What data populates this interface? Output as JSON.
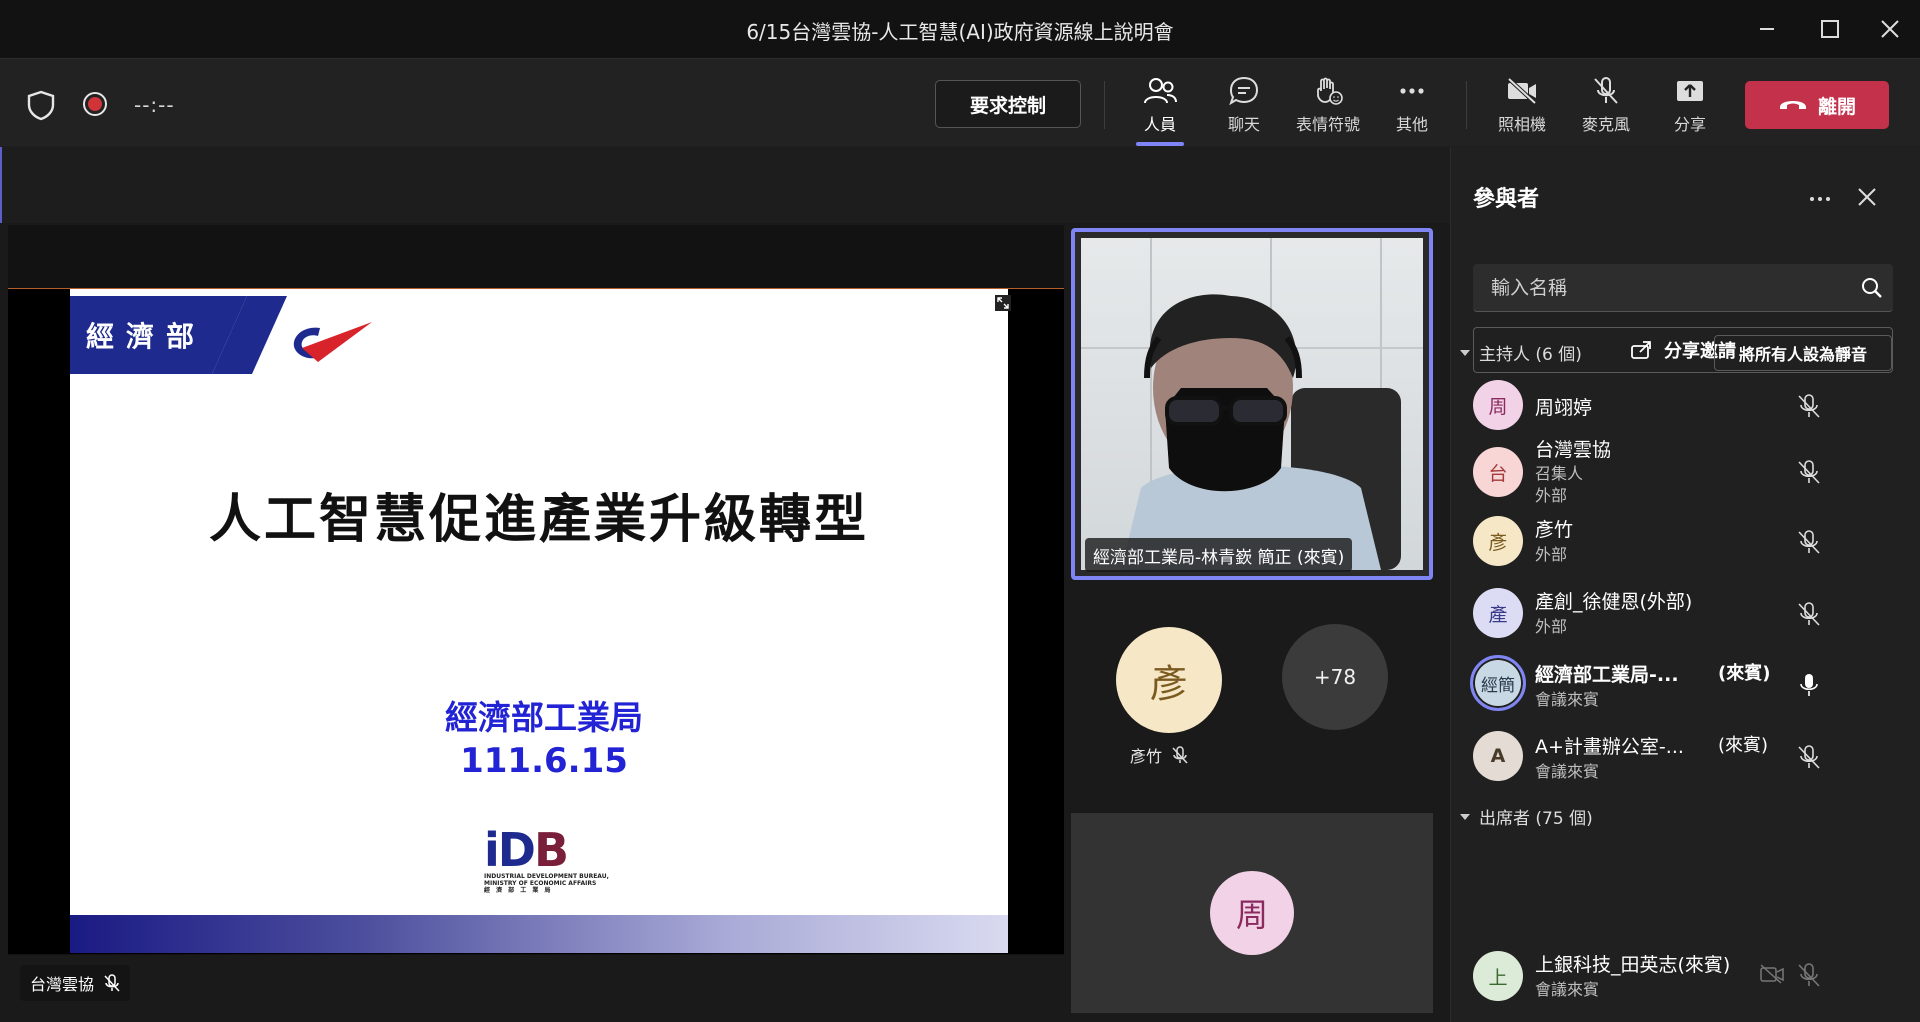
{
  "window": {
    "title": "6/15台灣雲協-人工智慧(AI)政府資源線上說明會"
  },
  "toolbar": {
    "timer": "--:--",
    "request_control": "要求控制",
    "items": {
      "people": "人員",
      "chat": "聊天",
      "reactions": "表情符號",
      "more": "其他",
      "camera": "照相機",
      "mic": "麥克風",
      "share": "分享"
    },
    "leave": "離開",
    "leave_color": "#c4314b",
    "accent_color": "#7f85f5"
  },
  "slide": {
    "banner": "經濟部",
    "title": "人工智慧促進產業升級轉型",
    "org": "經濟部工業局",
    "date": "111.6.15",
    "logo_text": "iDB",
    "logo_sub1": "INDUSTRIAL DEVELOPMENT BUREAU,",
    "logo_sub2": "MINISTRY OF ECONOMIC AFFAIRS",
    "logo_sub3": "經 濟 部 工 業 局"
  },
  "stage": {
    "presenter_tag": "台灣雲協",
    "video_name": "經濟部工業局-林青嶔 簡正 (來賓)",
    "mini_avatar_initial": "彥",
    "mini_avatar_name": "彥竹",
    "overflow_count": "+78",
    "bottom_avatar_initial": "周"
  },
  "panel": {
    "title": "參與者",
    "search_placeholder": "輸入名稱",
    "share_invite": "分享邀請",
    "organizers_header": "主持人 (6 個)",
    "mute_all": "將所有人設為靜音",
    "attendees_header": "出席者 (75 個)",
    "participants": [
      {
        "initial": "周",
        "name": "周翊婷",
        "sub1": "",
        "sub2": "",
        "tag": "",
        "mic": "muted"
      },
      {
        "initial": "台",
        "name": "台灣雲協",
        "sub1": "召集人",
        "sub2": "外部",
        "tag": "",
        "mic": "muted"
      },
      {
        "initial": "彥",
        "name": "彥竹",
        "sub1": "外部",
        "sub2": "",
        "tag": "",
        "mic": "muted"
      },
      {
        "initial": "產",
        "name": "產創_徐健恩(外部)",
        "sub1": "外部",
        "sub2": "",
        "tag": "",
        "mic": "muted"
      },
      {
        "initial": "經簡",
        "name": "經濟部工業局-...",
        "sub1": "會議來賓",
        "sub2": "",
        "tag": "(來賓)",
        "mic": "on"
      },
      {
        "initial": "A",
        "name": "A+計畫辦公室-...",
        "sub1": "會議來賓",
        "sub2": "",
        "tag": "(來賓)",
        "mic": "muted"
      }
    ],
    "attendees": [
      {
        "initial": "上",
        "name": "上銀科技_田英志(來賓)",
        "sub1": "會議來賓"
      }
    ]
  }
}
